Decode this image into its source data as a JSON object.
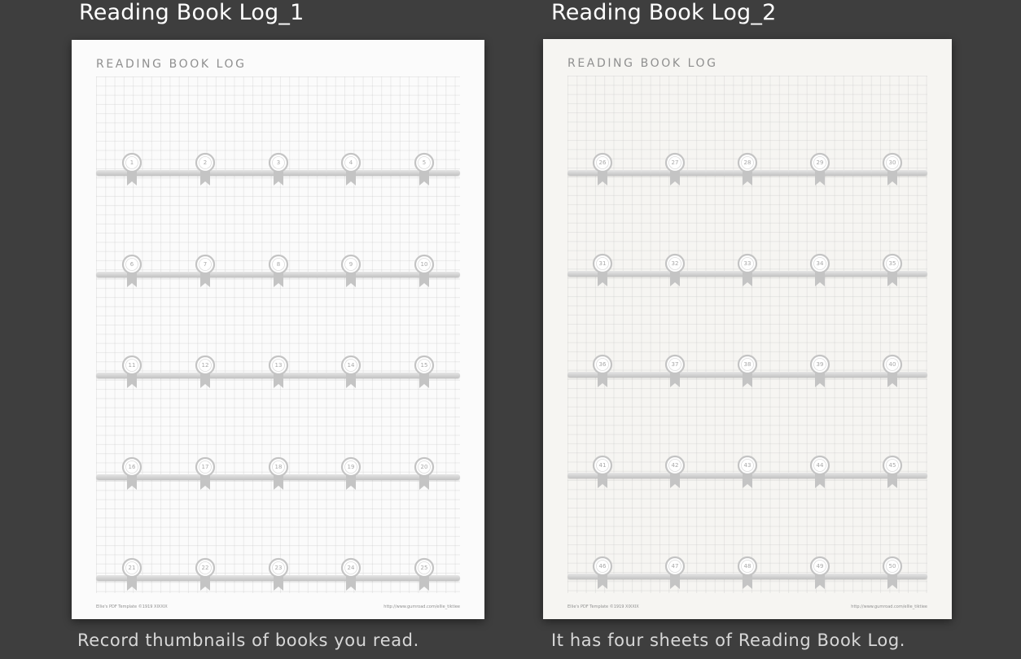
{
  "panels": [
    {
      "title": "Reading Book Log_1",
      "caption": "Record thumbnails of books you read.",
      "sheet": {
        "heading": "READING BOOK LOG",
        "background": "#fbfbfb",
        "badge_numbers": [
          "1",
          "2",
          "3",
          "4",
          "5",
          "6",
          "7",
          "8",
          "9",
          "10",
          "11",
          "12",
          "13",
          "14",
          "15",
          "16",
          "17",
          "18",
          "19",
          "20",
          "21",
          "22",
          "23",
          "24",
          "25"
        ],
        "footer_left": "Ellie's PDF Template ©1919 XIXXIX",
        "footer_right": "http://www.gumroad.com/ellie_tiktiee"
      }
    },
    {
      "title": "Reading Book Log_2",
      "caption": "It has four sheets of Reading Book Log.",
      "sheet": {
        "heading": "READING BOOK LOG",
        "background": "#f6f5f2",
        "badge_numbers": [
          "26",
          "27",
          "28",
          "29",
          "30",
          "31",
          "32",
          "33",
          "34",
          "35",
          "36",
          "37",
          "38",
          "39",
          "40",
          "41",
          "42",
          "43",
          "44",
          "45",
          "46",
          "47",
          "48",
          "49",
          "50"
        ],
        "footer_left": "Ellie's PDF Template ©1919 XIXXIX",
        "footer_right": "http://www.gumroad.com/ellie_tiktiee"
      }
    }
  ],
  "colors": {
    "background": "#3e3e3e",
    "title_text": "#ffffff",
    "caption_text": "#d8d8d8",
    "heading_text": "#8f8f8f",
    "badge": "#c4c4c4"
  }
}
